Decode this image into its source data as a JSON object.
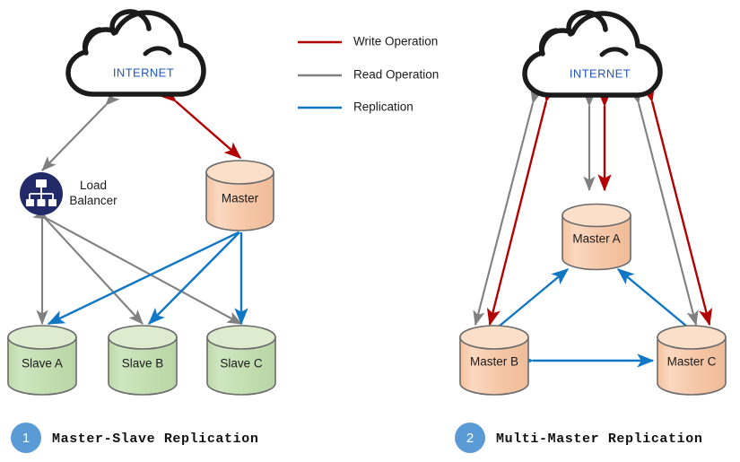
{
  "legend": {
    "items": [
      {
        "label": "Write Operation",
        "color": "#b30000",
        "icon": "line-swatch-icon"
      },
      {
        "label": "Read Operation",
        "color": "#808080",
        "icon": "line-swatch-icon"
      },
      {
        "label": "Replication",
        "color": "#1077c4",
        "icon": "line-swatch-icon"
      }
    ]
  },
  "colors": {
    "write": "#b30000",
    "read": "#808080",
    "replication": "#1077c4",
    "cloud_outline": "#1b1b1b",
    "cloud_text": "#2255bb",
    "db_master_fill": "#f7c9a7",
    "db_master_top": "#fbdfc9",
    "db_slave_fill": "#c6dfb5",
    "db_slave_top": "#ddeccf",
    "db_stroke": "#6b6b6b",
    "load_balancer": "#232a68",
    "badge": "#5b9bd5",
    "caption_text": "#111111"
  },
  "diagram1": {
    "caption": "Master-Slave Replication",
    "badge_number": "1",
    "cloud_label": "INTERNET",
    "load_balancer_label_line1": "Load",
    "load_balancer_label_line2": "Balancer",
    "master_label": "Master",
    "slaves": [
      {
        "label": "Slave A"
      },
      {
        "label": "Slave B"
      },
      {
        "label": "Slave C"
      }
    ]
  },
  "diagram2": {
    "caption": "Multi-Master Replication",
    "badge_number": "2",
    "cloud_label": "INTERNET",
    "masters": [
      {
        "label": "Master A"
      },
      {
        "label": "Master B"
      },
      {
        "label": "Master C"
      }
    ]
  }
}
